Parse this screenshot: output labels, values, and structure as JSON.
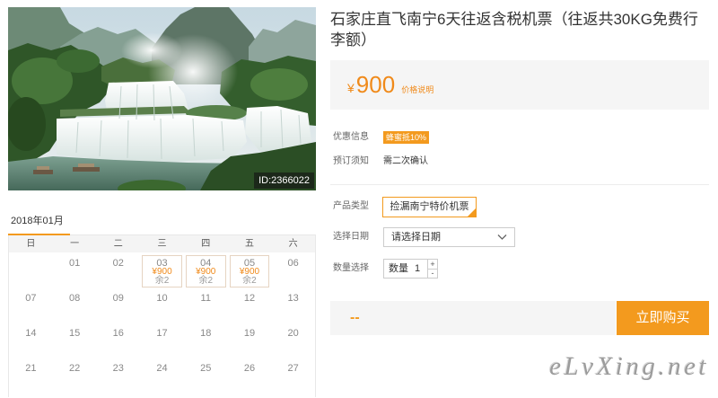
{
  "photo": {
    "id_label": "ID:2366022"
  },
  "calendar": {
    "month_label": "2018年01月",
    "weekdays": [
      "日",
      "一",
      "二",
      "三",
      "四",
      "五",
      "六"
    ],
    "weeks": [
      [
        {
          "day": ""
        },
        {
          "day": "01"
        },
        {
          "day": "02"
        },
        {
          "day": "03",
          "price": "¥900",
          "stock": "余2"
        },
        {
          "day": "04",
          "price": "¥900",
          "stock": "余2"
        },
        {
          "day": "05",
          "price": "¥900",
          "stock": "余2"
        },
        {
          "day": "06"
        }
      ],
      [
        {
          "day": "07"
        },
        {
          "day": "08"
        },
        {
          "day": "09"
        },
        {
          "day": "10"
        },
        {
          "day": "11"
        },
        {
          "day": "12"
        },
        {
          "day": "13"
        }
      ],
      [
        {
          "day": "14"
        },
        {
          "day": "15"
        },
        {
          "day": "16"
        },
        {
          "day": "17"
        },
        {
          "day": "18"
        },
        {
          "day": "19"
        },
        {
          "day": "20"
        }
      ],
      [
        {
          "day": "21"
        },
        {
          "day": "22"
        },
        {
          "day": "23"
        },
        {
          "day": "24"
        },
        {
          "day": "25"
        },
        {
          "day": "26"
        },
        {
          "day": "27"
        }
      ]
    ]
  },
  "product": {
    "title": "石家庄直飞南宁6天往返含税机票（往返共30KG免费行李额）"
  },
  "price": {
    "currency": "¥",
    "amount": "900",
    "note": "价格说明"
  },
  "info": {
    "promo_label": "优惠信息",
    "promo_badge": "蜂蜜抵10%",
    "notice_label": "预订须知",
    "notice_value": "需二次确认"
  },
  "options": {
    "type_label": "产品类型",
    "type_options": [
      {
        "label": "捡漏南宁特价机票",
        "selected": true
      }
    ],
    "date_label": "选择日期",
    "date_placeholder": "请选择日期",
    "qty_label": "数量选择",
    "qty_prefix": "数量",
    "qty_value": "1",
    "qty_plus": "+",
    "qty_minus": "-"
  },
  "buy_bar": {
    "total": "--",
    "button_label": "立即购买"
  },
  "watermark": "eLvXing.net",
  "colors": {
    "accent": "#f39a1e",
    "price": "#f08a1a",
    "panel_bg": "#f5f5f5",
    "border": "#e8e8e8"
  },
  "icons": {
    "date_dropdown": "chevron-down-icon",
    "selected_option": "check-corner-icon"
  }
}
